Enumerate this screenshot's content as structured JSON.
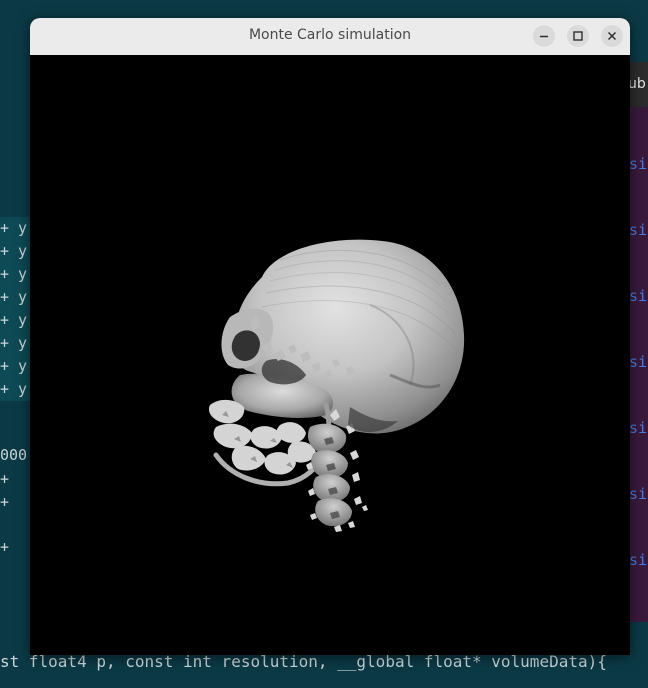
{
  "window": {
    "title": "Monte Carlo simulation"
  },
  "background": {
    "left_editor": {
      "diff_lines": [
        "+ y",
        "+ y",
        "+ y",
        "+ y",
        "+ y",
        "+ y",
        "+ y",
        "+ y"
      ],
      "number_fragment": "000",
      "plus_lines": [
        "+",
        "+",
        "+"
      ]
    },
    "right_window": {
      "tab_fragment": "ub (",
      "keyword_fragments": [
        "si",
        "si",
        "si",
        "si",
        "si",
        "si",
        "si"
      ]
    },
    "bottom_code_line": "st float4 p, const int resolution, __global float* volumeData){"
  },
  "viewport": {
    "render_subject": "skull-volume-render",
    "background_color": "#000000"
  }
}
